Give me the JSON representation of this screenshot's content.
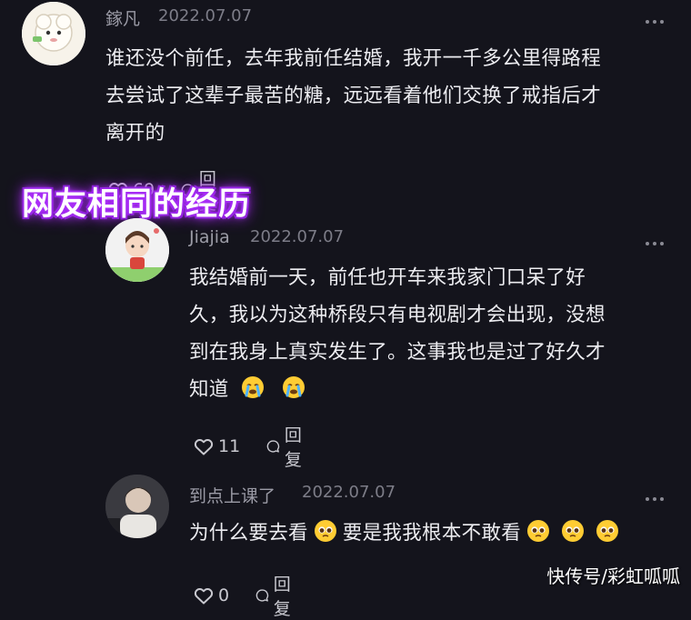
{
  "overlay_title": "网友相同的经历",
  "watermark": "快传号/彩虹呱呱",
  "comments": [
    {
      "username": "鎵凡",
      "date": "2022.07.07",
      "lines": [
        "谁还没个前任，去年我前任结婚，我开一千多公里得路程",
        "去尝试了这辈子最苦的糖，远远看着他们交换了戒指后才",
        "离开的"
      ],
      "like_count": "69",
      "reply_label": "回复"
    },
    {
      "username": "Jiajia",
      "date": "2022.07.07",
      "lines": [
        "我结婚前一天，前任也开车来我家门口呆了好",
        "久，我以为这种桥段只有电视剧才会出现，没想",
        "到在我身上真实发生了。这事我也是过了好久才",
        "知道"
      ],
      "emojis": [
        "crying-face-emoji",
        "crying-face-emoji"
      ],
      "like_count": "11",
      "reply_label": "回复"
    },
    {
      "username": "到点上课了",
      "date": "2022.07.07",
      "text_a": "为什么要去看",
      "text_b": "要是我我根本不敢看",
      "emojis": [
        "pleading-face-emoji",
        "pleading-face-emoji",
        "pleading-face-emoji",
        "pleading-face-emoji"
      ],
      "like_count": "0",
      "reply_label": "回复"
    }
  ]
}
